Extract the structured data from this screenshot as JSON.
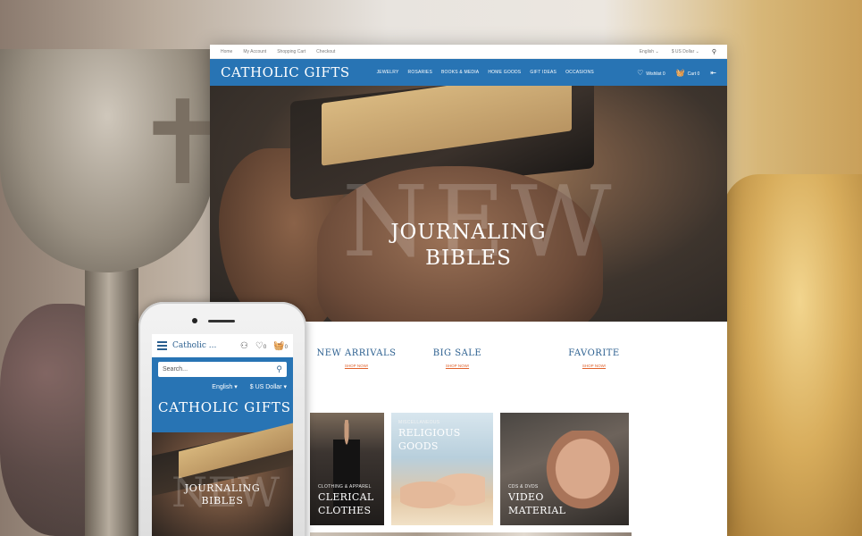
{
  "desktop": {
    "topbar": {
      "links": [
        "Home",
        "My Account",
        "Shopping Cart",
        "Checkout"
      ],
      "language": "English",
      "currency": "$ US Dollar"
    },
    "navbar": {
      "logo": "CATHOLIC GIFTS",
      "menu": [
        "JEWELRY",
        "ROSARIES",
        "BOOKS & MEDIA",
        "HOME GOODS",
        "GIFT IDEAS",
        "OCCASIONS"
      ],
      "wishlist": "Wishlist 0",
      "cart": "Cart 0"
    },
    "hero": {
      "ghost_text": "NEW",
      "title_line1": "JOURNALING",
      "title_line2": "BIBLES"
    },
    "features": [
      {
        "title": "NEW ARRIVALS",
        "link": "SHOP NOW!"
      },
      {
        "title": "BIG SALE",
        "link": "SHOP NOW!"
      },
      {
        "title": "FAVORITE",
        "link": "SHOP NOW!"
      }
    ],
    "tiles": [
      {
        "category": "CLOTHING & APPAREL",
        "name_line1": "CLERICAL",
        "name_line2": "CLOTHES"
      },
      {
        "category": "MISCELLANEOUS",
        "name_line1": "RELIGIOUS",
        "name_line2": "GOODS"
      },
      {
        "category": "CDS & DVDS",
        "name_line1": "VIDEO",
        "name_line2": "MATERIAL"
      }
    ]
  },
  "mobile": {
    "logo": "Catholic ...",
    "wishlist_count": "0",
    "cart_count": "0",
    "search_placeholder": "Search...",
    "language": "English",
    "currency": "$ US Dollar",
    "brand": "CATHOLIC GIFTS",
    "hero_ghost": "NEW",
    "hero_line1": "JOURNALING",
    "hero_line2": "BIBLES"
  },
  "colors": {
    "brand_blue": "#2874b4",
    "heading_blue": "#2b5f8f",
    "link_orange": "#e0622c"
  },
  "icons": [
    "heart-icon",
    "cart-icon",
    "search-icon",
    "user-icon",
    "menu-icon",
    "chevron-down-icon",
    "exit-icon"
  ]
}
